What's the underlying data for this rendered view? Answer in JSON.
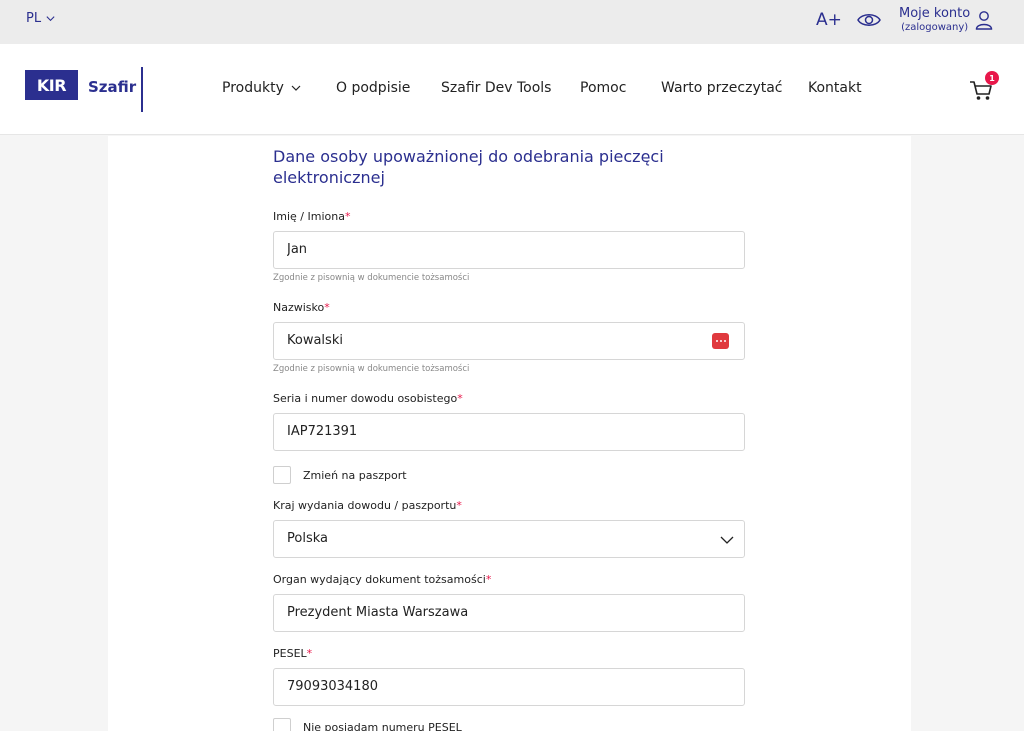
{
  "topbar": {
    "language": "PL",
    "font_size_label": "A+",
    "account_label": "Moje konto",
    "account_status": "(zalogowany)"
  },
  "brand": {
    "kir": "KIR",
    "szafir": "Szafir"
  },
  "nav": {
    "items": [
      {
        "label": "Produkty"
      },
      {
        "label": "O podpisie"
      },
      {
        "label": "Szafir Dev Tools"
      },
      {
        "label": "Pomoc"
      },
      {
        "label": "Warto przeczytać"
      },
      {
        "label": "Kontakt"
      }
    ],
    "cart_count": "1"
  },
  "form": {
    "section_title": "Dane osoby upoważnionej do odebrania pieczęci elektronicznej",
    "required_mark": "*",
    "first_name": {
      "label": "Imię / Imiona",
      "value": "Jan",
      "hint": "Zgodnie z pisownią w dokumencie tożsamości"
    },
    "last_name": {
      "label": "Nazwisko",
      "value": "Kowalski",
      "hint": "Zgodnie z pisownią w dokumencie tożsamości"
    },
    "id_number": {
      "label": "Seria i numer dowodu osobistego",
      "value": "IAP721391"
    },
    "passport_toggle": {
      "label": "Zmień na paszport",
      "checked": false
    },
    "issuing_country": {
      "label": "Kraj wydania dowodu / paszportu",
      "value": "Polska"
    },
    "issuing_authority": {
      "label": "Organ wydający dokument tożsamości",
      "value": "Prezydent Miasta Warszawa"
    },
    "pesel": {
      "label": "PESEL",
      "value": "79093034180"
    },
    "no_pesel": {
      "label": "Nie posiadam numeru PESEL",
      "checked": false
    }
  },
  "colors": {
    "brand": "#2b2f8f",
    "required": "#e8174a",
    "password_manager": "#e0393e"
  }
}
